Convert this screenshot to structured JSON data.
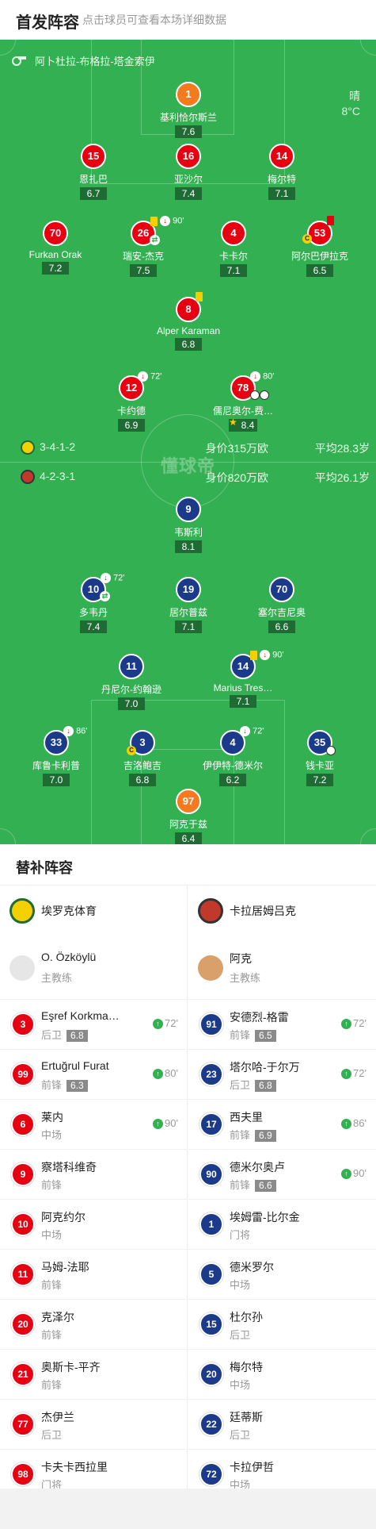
{
  "header": {
    "title": "首发阵容",
    "subtitle": "点击球员可查看本场详细数据"
  },
  "venue": "阿卜杜拉-布格拉-塔金索伊",
  "weather": {
    "condition": "晴",
    "temp": "8°C"
  },
  "watermark": "懂球帝",
  "home": {
    "formation": "3-4-1-2",
    "value": "身价315万欧",
    "age": "平均28.3岁",
    "players": [
      {
        "num": "1",
        "name": "基利恰尔斯兰",
        "rating": "7.6",
        "gk": true
      },
      {
        "num": "15",
        "name": "恩扎巴",
        "rating": "6.7"
      },
      {
        "num": "16",
        "name": "亚沙尔",
        "rating": "7.4"
      },
      {
        "num": "14",
        "name": "梅尔特",
        "rating": "7.1"
      },
      {
        "num": "70",
        "name": "Furkan Orak",
        "rating": "7.2"
      },
      {
        "num": "26",
        "name": "瑞安-杰克",
        "rating": "7.5",
        "minute": "90'"
      },
      {
        "num": "4",
        "name": "卡卡尔",
        "rating": "7.1"
      },
      {
        "num": "53",
        "name": "阿尔巴伊拉克",
        "rating": "6.5"
      },
      {
        "num": "8",
        "name": "Alper Karaman",
        "rating": "6.8"
      },
      {
        "num": "12",
        "name": "卡约德",
        "rating": "6.9",
        "minute": "72'"
      },
      {
        "num": "78",
        "name": "儒尼奥尔-费…",
        "rating": "8.4",
        "minute": "80'"
      }
    ]
  },
  "away": {
    "formation": "4-2-3-1",
    "value": "身价820万欧",
    "age": "平均26.1岁",
    "players": [
      {
        "num": "9",
        "name": "韦斯利",
        "rating": "8.1"
      },
      {
        "num": "10",
        "name": "多韦丹",
        "rating": "7.4",
        "minute": "72'"
      },
      {
        "num": "19",
        "name": "居尔普兹",
        "rating": "7.1"
      },
      {
        "num": "70",
        "name": "塞尔吉尼奥",
        "rating": "6.6"
      },
      {
        "num": "11",
        "name": "丹尼尔-约翰逊",
        "rating": "7.0"
      },
      {
        "num": "14",
        "name": "Marius Tres…",
        "rating": "7.1",
        "minute": "90'"
      },
      {
        "num": "33",
        "name": "库鲁卡利普",
        "rating": "7.0",
        "minute": "86'"
      },
      {
        "num": "3",
        "name": "吉洛鲍吉",
        "rating": "6.8"
      },
      {
        "num": "4",
        "name": "伊伊特-德米尔",
        "rating": "6.2",
        "minute": "72'"
      },
      {
        "num": "35",
        "name": "钱卡亚",
        "rating": "7.2"
      },
      {
        "num": "97",
        "name": "阿克于兹",
        "rating": "6.4",
        "gk": true
      }
    ]
  },
  "bench": {
    "title": "替补阵容",
    "home_team": "埃罗克体育",
    "away_team": "卡拉居姆吕克",
    "home_coach": {
      "name": "O. Özköylü",
      "role": "主教练"
    },
    "away_coach": {
      "name": "阿克",
      "role": "主教练"
    },
    "home": [
      {
        "num": "3",
        "name": "Eşref Korkma…",
        "pos": "后卫",
        "rating": "6.8",
        "in": "72'"
      },
      {
        "num": "99",
        "name": "Ertuğrul Furat",
        "pos": "前锋",
        "rating": "6.3",
        "in": "80'"
      },
      {
        "num": "6",
        "name": "莱内",
        "pos": "中场",
        "rating": "",
        "in": "90'"
      },
      {
        "num": "9",
        "name": "察塔科维奇",
        "pos": "前锋",
        "rating": "",
        "in": ""
      },
      {
        "num": "10",
        "name": "阿克约尔",
        "pos": "中场",
        "rating": "",
        "in": ""
      },
      {
        "num": "11",
        "name": "马姆-法耶",
        "pos": "前锋",
        "rating": "",
        "in": ""
      },
      {
        "num": "20",
        "name": "克泽尔",
        "pos": "前锋",
        "rating": "",
        "in": ""
      },
      {
        "num": "21",
        "name": "奥斯卡-平齐",
        "pos": "前锋",
        "rating": "",
        "in": ""
      },
      {
        "num": "77",
        "name": "杰伊兰",
        "pos": "后卫",
        "rating": "",
        "in": ""
      },
      {
        "num": "98",
        "name": "卡夫卡西拉里",
        "pos": "门将",
        "rating": "",
        "in": ""
      }
    ],
    "away": [
      {
        "num": "91",
        "name": "安德烈-格雷",
        "pos": "前锋",
        "rating": "6.5",
        "in": "72'"
      },
      {
        "num": "23",
        "name": "塔尔哈-于尔万",
        "pos": "后卫",
        "rating": "6.8",
        "in": "72'"
      },
      {
        "num": "17",
        "name": "西夫里",
        "pos": "前锋",
        "rating": "6.9",
        "in": "86'"
      },
      {
        "num": "90",
        "name": "德米尔奥卢",
        "pos": "前锋",
        "rating": "6.6",
        "in": "90'"
      },
      {
        "num": "1",
        "name": "埃姆雷-比尔金",
        "pos": "门将",
        "rating": "",
        "in": ""
      },
      {
        "num": "5",
        "name": "德米罗尔",
        "pos": "中场",
        "rating": "",
        "in": ""
      },
      {
        "num": "15",
        "name": "杜尔孙",
        "pos": "后卫",
        "rating": "",
        "in": ""
      },
      {
        "num": "20",
        "name": "梅尔特",
        "pos": "中场",
        "rating": "",
        "in": ""
      },
      {
        "num": "22",
        "name": "廷蒂斯",
        "pos": "后卫",
        "rating": "",
        "in": ""
      },
      {
        "num": "72",
        "name": "卡拉伊哲",
        "pos": "中场",
        "rating": "",
        "in": ""
      }
    ]
  }
}
